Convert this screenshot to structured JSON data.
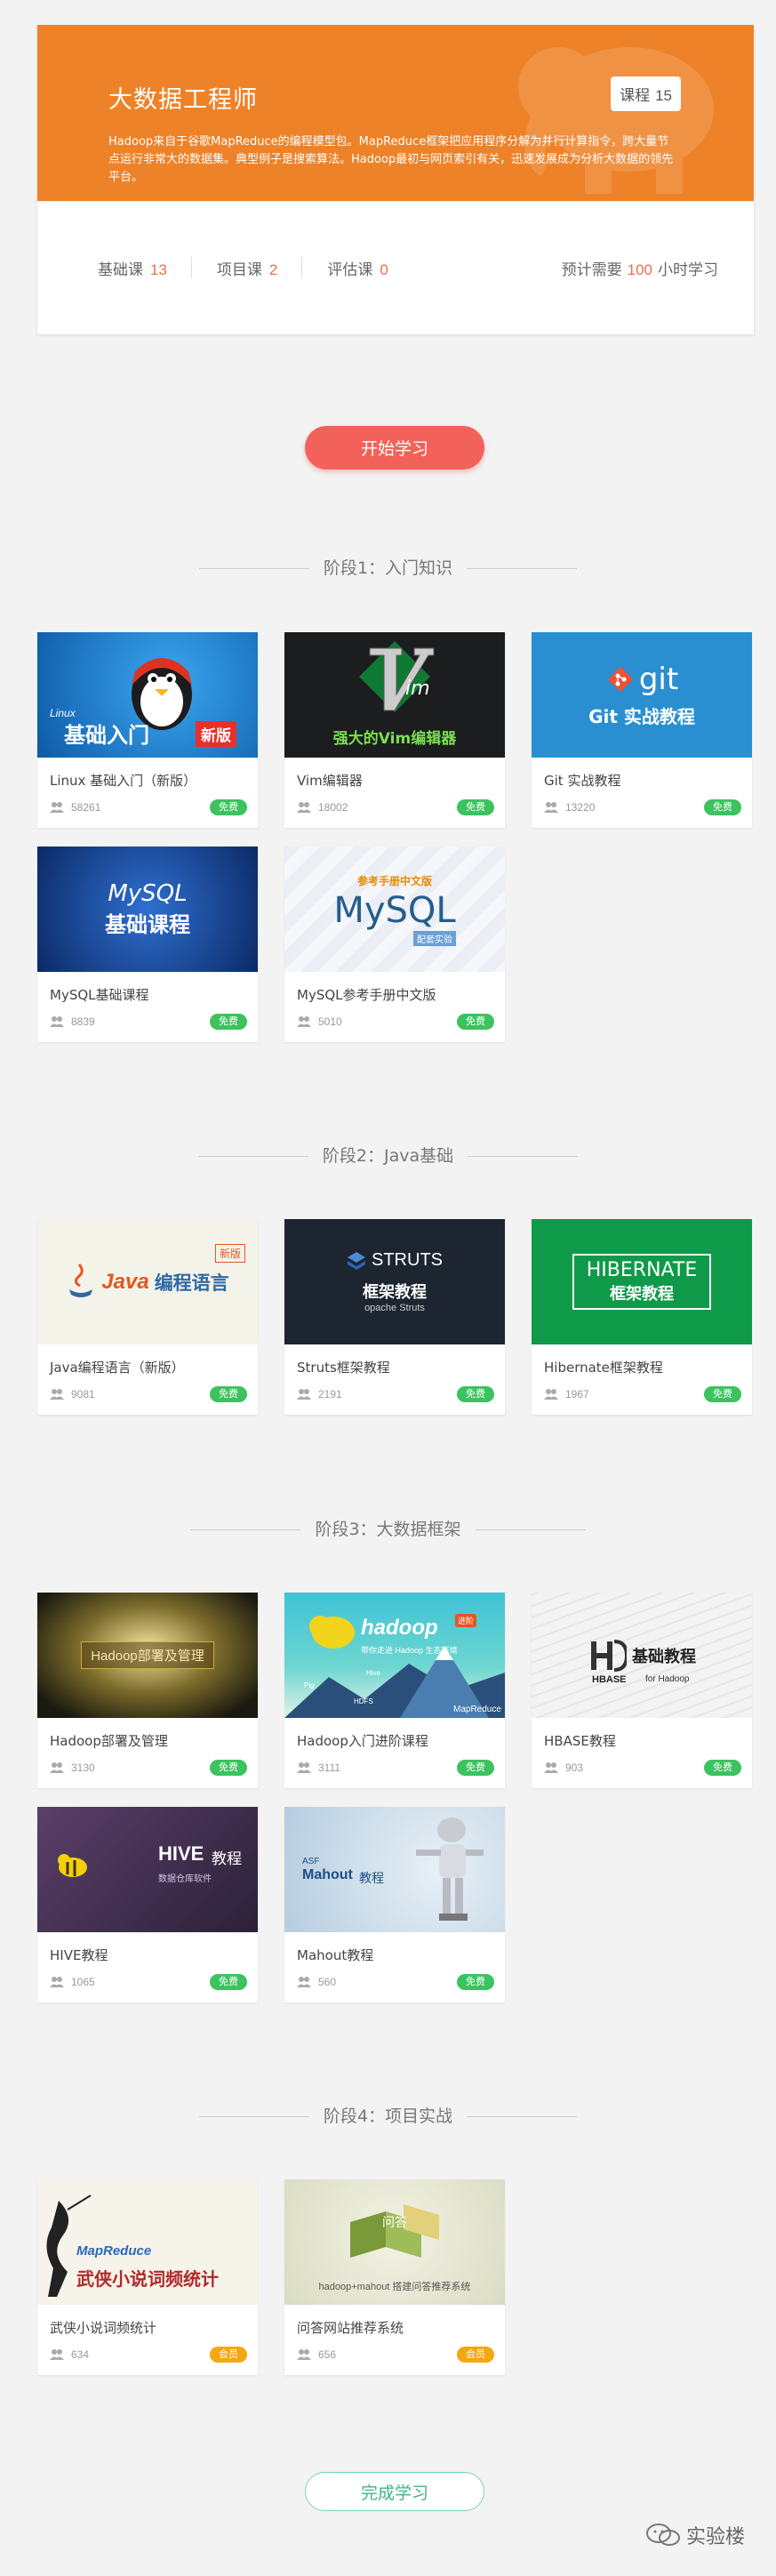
{
  "header": {
    "title": "大数据工程师",
    "badge_label": "课程",
    "badge_count": "15",
    "description": "Hadoop来自于谷歌MapReduce的编程模型包。MapReduce框架把应用程序分解为并行计算指令，跨大量节点运行非常大的数据集。典型例子是搜索算法。Hadoop最初与网页索引有关，迅速发展成为分析大数据的领先平台。",
    "stats": [
      {
        "label": "基础课",
        "value": "13"
      },
      {
        "label": "项目课",
        "value": "2"
      },
      {
        "label": "评估课",
        "value": "0"
      }
    ],
    "time_prefix": "预计需要",
    "time_value": "100",
    "time_suffix": "小时学习"
  },
  "start_button": "开始学习",
  "finish_button": "完成学习",
  "stages": [
    {
      "title": "阶段1：入门知识",
      "courses": [
        {
          "title": "Linux 基础入门（新版）",
          "learners": "58261",
          "badge": "免费",
          "thumb_text": "基础入门",
          "thumb_sub": "Linux",
          "thumb_tag": "新版"
        },
        {
          "title": "Vim编辑器",
          "learners": "18002",
          "badge": "免费",
          "thumb_text": "强大的Vim编辑器"
        },
        {
          "title": "Git 实战教程",
          "learners": "13220",
          "badge": "免费",
          "thumb_text": "Git 实战教程",
          "thumb_logo": "git"
        },
        {
          "title": "MySQL基础课程",
          "learners": "8839",
          "badge": "免费",
          "thumb_text": "基础课程",
          "thumb_logo": "MySQL"
        },
        {
          "title": "MySQL参考手册中文版",
          "learners": "5010",
          "badge": "免费",
          "thumb_text": "参考手册中文版",
          "thumb_logo": "MySQL",
          "thumb_tag": "配套实验"
        }
      ]
    },
    {
      "title": "阶段2：Java基础",
      "courses": [
        {
          "title": "Java编程语言（新版）",
          "learners": "9081",
          "badge": "免费",
          "thumb_text": "编程语言",
          "thumb_logo": "Java",
          "thumb_tag": "新版"
        },
        {
          "title": "Struts框架教程",
          "learners": "2191",
          "badge": "免费",
          "thumb_text": "框架教程",
          "thumb_logo": "STRUTS",
          "thumb_sub": "opache Struts"
        },
        {
          "title": "Hibernate框架教程",
          "learners": "1967",
          "badge": "免费",
          "thumb_text": "框架教程",
          "thumb_logo": "HIBERNATE"
        }
      ]
    },
    {
      "title": "阶段3：大数据框架",
      "courses": [
        {
          "title": "Hadoop部署及管理",
          "learners": "3130",
          "badge": "免费",
          "thumb_text": "Hadoop部署及管理"
        },
        {
          "title": "Hadoop入门进阶课程",
          "learners": "3111",
          "badge": "免费",
          "thumb_text": "带你走进 Hadoop 生态环境",
          "thumb_logo": "hadoop",
          "thumb_tag": "进阶",
          "thumb_labels": [
            "Hive",
            "Pig",
            "HDFS",
            "MapReduce"
          ]
        },
        {
          "title": "HBASE教程",
          "learners": "903",
          "badge": "免费",
          "thumb_text": "基础教程",
          "thumb_logo": "HBASE",
          "thumb_sub": "for Hadoop"
        },
        {
          "title": "HIVE教程",
          "learners": "1065",
          "badge": "免费",
          "thumb_text": "教程",
          "thumb_logo": "HIVE",
          "thumb_sub": "数据仓库软件"
        },
        {
          "title": "Mahout教程",
          "learners": "560",
          "badge": "免费",
          "thumb_text": "教程",
          "thumb_logo": "Mahout",
          "thumb_sub": "ASF"
        }
      ]
    },
    {
      "title": "阶段4：项目实战",
      "courses": [
        {
          "title": "武侠小说词频统计",
          "learners": "634",
          "badge": "会员",
          "thumb_text": "武侠小说词频统计",
          "thumb_logo": "MapReduce"
        },
        {
          "title": "问答网站推荐系统",
          "learners": "656",
          "badge": "会员",
          "thumb_text": "hadoop+mahout 搭建问答推荐系统",
          "thumb_logo": "问答"
        }
      ]
    }
  ],
  "watermark": "实验楼",
  "colors": {
    "hero_bg": "#ee8228",
    "accent_red": "#f2625a",
    "free_badge": "#3cc25f",
    "member_badge": "#f4a711"
  }
}
